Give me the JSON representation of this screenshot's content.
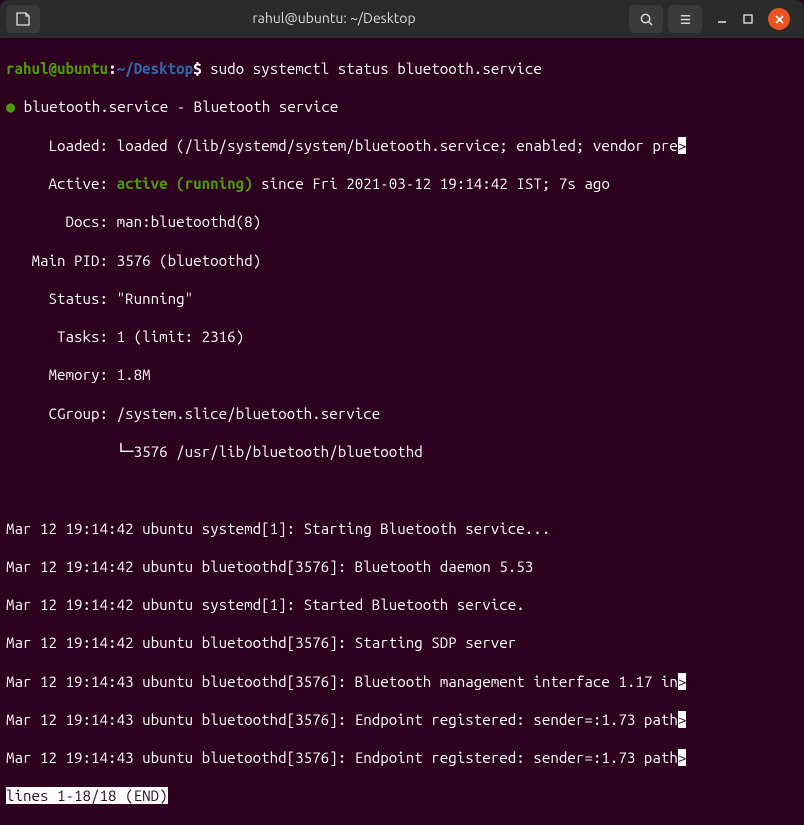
{
  "titlebar": {
    "title": "rahul@ubuntu: ~/Desktop"
  },
  "prompt": {
    "user_host": "rahul@ubuntu",
    "colon": ":",
    "path": "~/Desktop",
    "dollar": "$",
    "command": "sudo systemctl status bluetooth.service"
  },
  "status": {
    "dot": "●",
    "unit_line": " bluetooth.service - Bluetooth service",
    "loaded_label": "     Loaded:",
    "loaded_value": " loaded (/lib/systemd/system/bluetooth.service; enabled; vendor pre",
    "loaded_caret": ">",
    "active_label": "     Active:",
    "active_state": "active (running)",
    "active_since": " since Fri 2021-03-12 19:14:42 IST; 7s ago",
    "docs_label": "       Docs:",
    "docs_value": " man:bluetoothd(8)",
    "mainpid_label": "   Main PID:",
    "mainpid_value": " 3576 (bluetoothd)",
    "status_label": "     Status:",
    "status_value": " \"Running\"",
    "tasks_label": "      Tasks:",
    "tasks_value": " 1 (limit: 2316)",
    "memory_label": "     Memory:",
    "memory_value": " 1.8M",
    "cgroup_label": "     CGroup:",
    "cgroup_value": " /system.slice/bluetooth.service",
    "cgroup_child": "             └─3576 /usr/lib/bluetooth/bluetoothd"
  },
  "log": [
    "Mar 12 19:14:42 ubuntu systemd[1]: Starting Bluetooth service...",
    "Mar 12 19:14:42 ubuntu bluetoothd[3576]: Bluetooth daemon 5.53",
    "Mar 12 19:14:42 ubuntu systemd[1]: Started Bluetooth service.",
    "Mar 12 19:14:42 ubuntu bluetoothd[3576]: Starting SDP server",
    "Mar 12 19:14:43 ubuntu bluetoothd[3576]: Bluetooth management interface 1.17 in",
    "Mar 12 19:14:43 ubuntu bluetoothd[3576]: Endpoint registered: sender=:1.73 path",
    "Mar 12 19:14:43 ubuntu bluetoothd[3576]: Endpoint registered: sender=:1.73 path"
  ],
  "log_caret": ">",
  "pager": "lines 1-18/18 (END)"
}
